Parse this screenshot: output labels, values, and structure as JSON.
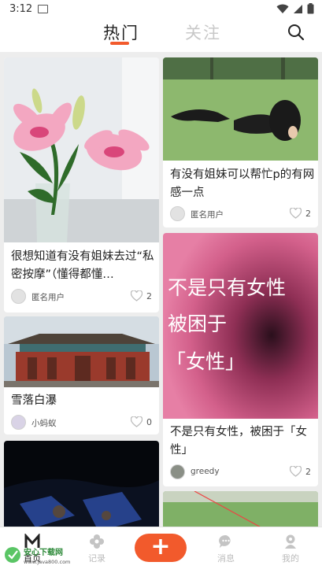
{
  "status_bar": {
    "time": "3:12"
  },
  "header": {
    "tabs": [
      {
        "label": "热门",
        "active": true
      },
      {
        "label": "关注",
        "active": false
      }
    ],
    "accent_color": "#f25a2c"
  },
  "feed": {
    "cards": [
      {
        "title": "很想知道有没有姐妹去过“私密按摩”（懂得都懂…",
        "author": "匿名用户",
        "likes": "2",
        "image": "pink-lily-flowers"
      },
      {
        "title": "雪落白瀑",
        "author": "小蚂蚁",
        "likes": "0",
        "image": "chinese-temple"
      },
      {
        "title": "",
        "author": "",
        "likes": "",
        "image": "night-tree-reflection"
      },
      {
        "title": "有没有姐妹可以帮忙p的有网感一点",
        "author": "匿名用户",
        "likes": "2",
        "image": "girl-on-grass"
      },
      {
        "title": "不是只有女性，被困于「女性」",
        "author": "greedy",
        "likes": "2",
        "image": "pink-poster",
        "image_text": [
          "不是只有女性",
          "被困于",
          "「女性」"
        ]
      },
      {
        "title": "",
        "author": "",
        "likes": "",
        "image": "green-lawn"
      }
    ]
  },
  "bottom_nav": {
    "items": [
      {
        "label": "首页",
        "icon": "home-m-icon"
      },
      {
        "label": "记录",
        "icon": "flower-icon"
      },
      {
        "label": "",
        "icon": "plus-icon"
      },
      {
        "label": "消息",
        "icon": "chat-icon"
      },
      {
        "label": "我的",
        "icon": "user-icon"
      }
    ]
  },
  "watermark": {
    "name": "安心下载网",
    "url": "www.java800.com"
  }
}
